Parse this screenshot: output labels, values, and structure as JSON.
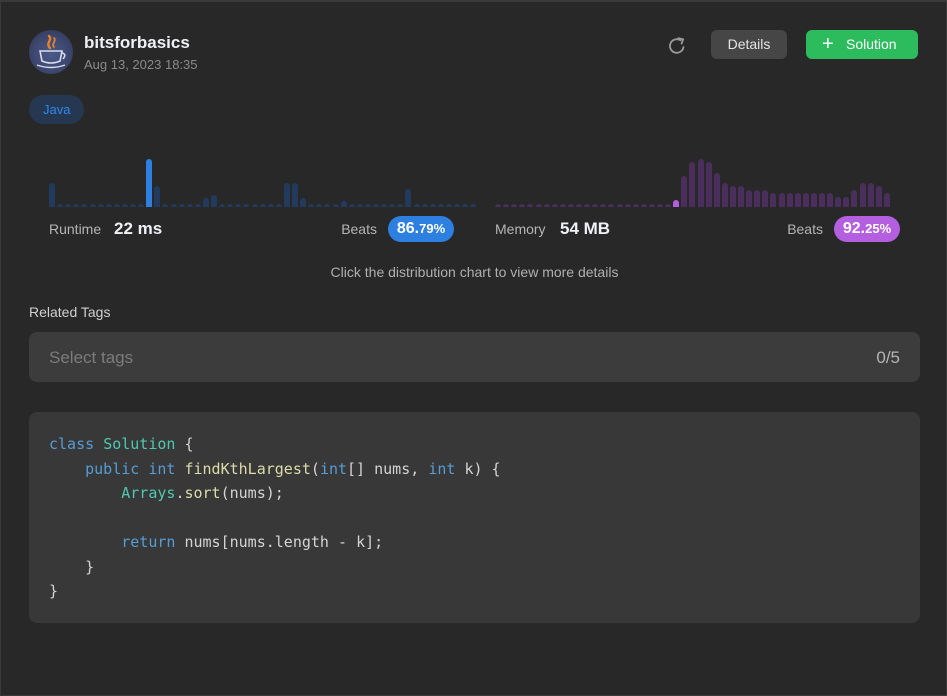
{
  "submission": {
    "username": "bitsforbasics",
    "timestamp": "Aug 13, 2023 18:35",
    "language": "Java"
  },
  "buttons": {
    "details_label": "Details",
    "solution_label": "Solution"
  },
  "icons": {
    "refresh": "refresh-icon",
    "plus": "plus-icon",
    "avatar": "java-coffee-cup"
  },
  "runtime": {
    "label": "Runtime",
    "value": "22 ms",
    "beats_label": "Beats",
    "beats_int": "86.",
    "beats_dec": "79%",
    "color": "#2d7fe0",
    "dim_color": "#223a5c",
    "distribution": [
      8,
      1,
      1,
      1,
      1,
      1,
      1,
      1,
      1,
      1,
      1,
      1,
      16,
      7,
      1,
      1,
      1,
      1,
      1,
      3,
      4,
      1,
      1,
      1,
      1,
      1,
      1,
      1,
      1,
      8,
      8,
      3,
      1,
      1,
      1,
      1,
      2,
      1,
      1,
      1,
      1,
      1,
      1,
      1,
      6,
      1,
      1,
      1,
      1,
      1,
      1,
      1,
      1
    ],
    "selected_index": 12
  },
  "memory": {
    "label": "Memory",
    "value": "54 MB",
    "beats_label": "Beats",
    "beats_int": "92.",
    "beats_dec": "25%",
    "color": "#b45ee0",
    "dim_color": "#4a2f5c",
    "distribution": [
      1,
      1,
      1,
      1,
      1,
      1,
      1,
      1,
      1,
      1,
      1,
      1,
      1,
      1,
      1,
      1,
      1,
      1,
      1,
      1,
      1,
      1,
      2,
      9,
      13,
      14,
      13,
      10,
      7,
      6,
      6,
      5,
      5,
      5,
      4,
      4,
      4,
      4,
      4,
      4,
      4,
      4,
      3,
      3,
      5,
      7,
      7,
      6,
      4
    ],
    "selected_index": 22
  },
  "hint_text": "Click the distribution chart to view more details",
  "related_tags": {
    "title": "Related Tags",
    "placeholder": "Select tags",
    "count": "0/5"
  },
  "code": {
    "language": "java",
    "lines": [
      "class Solution {",
      "    public int findKthLargest(int[] nums, int k) {",
      "        Arrays.sort(nums);",
      "",
      "        return nums[nums.length - k];",
      "    }",
      "}"
    ]
  }
}
